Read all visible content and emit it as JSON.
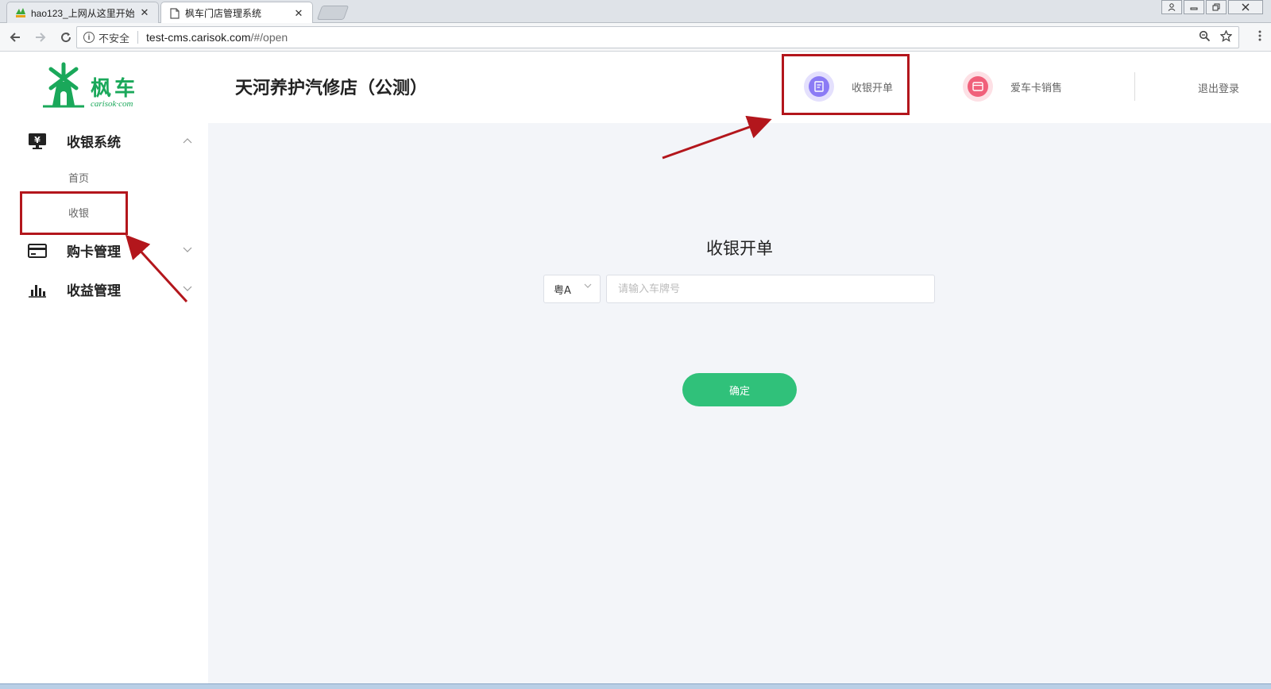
{
  "browser": {
    "tabs": [
      {
        "title": "hao123_上网从这里开始",
        "close": "✕",
        "favicon": "hao123-favicon-icon"
      },
      {
        "title": "枫车门店管理系统",
        "close": "✕",
        "favicon": "page-icon"
      }
    ],
    "address": {
      "security_label": "不安全",
      "url_host": "test-cms.carisok.com",
      "url_path": "/#/open"
    }
  },
  "app": {
    "logo": {
      "text": "枫车",
      "subtitle": "carisok·com"
    },
    "sidebar": {
      "groups": [
        {
          "label": "收银系统",
          "icon": "cashier-monitor-icon",
          "arrow": "⌃",
          "expanded": true
        },
        {
          "label": "购卡管理",
          "icon": "card-icon",
          "arrow": "⌄",
          "expanded": false
        },
        {
          "label": "收益管理",
          "icon": "bar-chart-icon",
          "arrow": "⌄",
          "expanded": false
        }
      ],
      "submenu": [
        {
          "label": "首页"
        },
        {
          "label": "收银"
        }
      ]
    },
    "header": {
      "shop_title": "天河养护汽修店（公测）",
      "actions": [
        {
          "label": "收银开单",
          "icon": "order-icon",
          "color": "#8b7bf5"
        },
        {
          "label": "爱车卡销售",
          "icon": "wallet-card-icon",
          "color": "#f0607a"
        }
      ],
      "logout": "退出登录"
    },
    "form": {
      "title": "收银开单",
      "province": "粤A",
      "plate_placeholder": "请输入车牌号",
      "confirm": "确定"
    },
    "colors": {
      "brand_green": "#1aa85a",
      "button_green": "#30c17a",
      "annotation_red": "#b3161c"
    }
  }
}
